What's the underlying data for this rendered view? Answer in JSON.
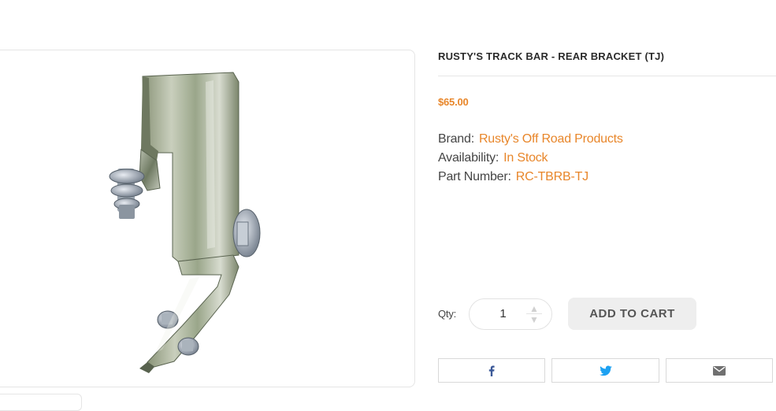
{
  "product": {
    "title": "RUSTY'S TRACK BAR - REAR BRACKET (TJ)",
    "price": "$65.00",
    "image_alt": "Rusty's Track Bar rear bracket"
  },
  "specs": [
    {
      "label": "Brand:",
      "value": "Rusty's Off Road Products"
    },
    {
      "label": "Availability:",
      "value": "In Stock"
    },
    {
      "label": "Part Number:",
      "value": "RC-TBRB-TJ"
    }
  ],
  "purchase": {
    "qty_label": "Qty:",
    "qty_value": "1",
    "add_to_cart": "ADD TO CART"
  },
  "share": {
    "facebook_icon": "facebook-icon",
    "twitter_icon": "twitter-icon",
    "email_icon": "email-icon"
  },
  "colors": {
    "accent": "#e8862a",
    "facebook": "#3b5998",
    "twitter": "#1da1f2",
    "email": "#707070"
  }
}
